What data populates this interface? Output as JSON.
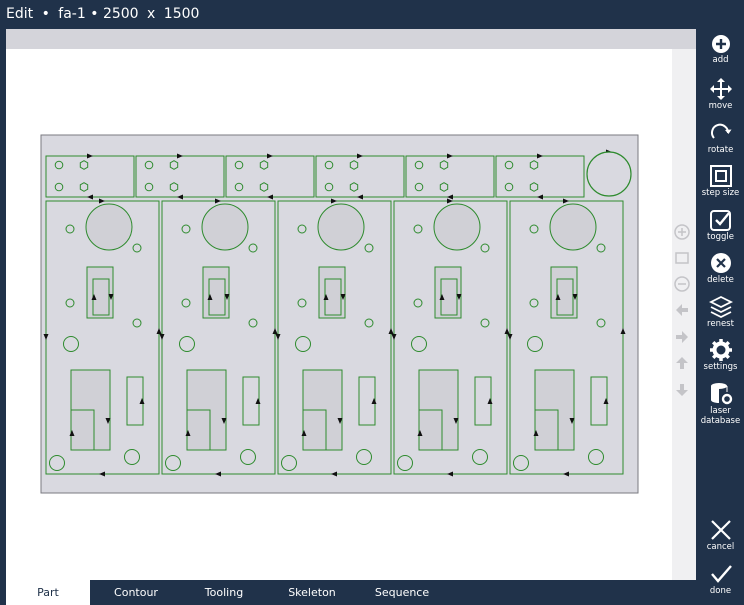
{
  "titlebar": {
    "mode": "Edit",
    "separator": "•",
    "part_name": "fa-1",
    "width": "2500",
    "times": "x",
    "height": "1500"
  },
  "toolbar": {
    "add": "add",
    "move": "move",
    "rotate": "rotate",
    "step_size": "step size",
    "toggle": "toggle",
    "delete": "delete",
    "renest": "renest",
    "settings": "settings",
    "laser_database_1": "laser",
    "laser_database_2": "database",
    "cancel": "cancel",
    "done": "done"
  },
  "tabs": [
    "Part",
    "Contour",
    "Tooling",
    "Skeleton",
    "Sequence"
  ],
  "active_tab": "Part",
  "colors": {
    "background": "#20324a",
    "sheet_fill": "#d8d8de",
    "cut_path": "#2e8b2e",
    "canvas": "#ffffff"
  }
}
